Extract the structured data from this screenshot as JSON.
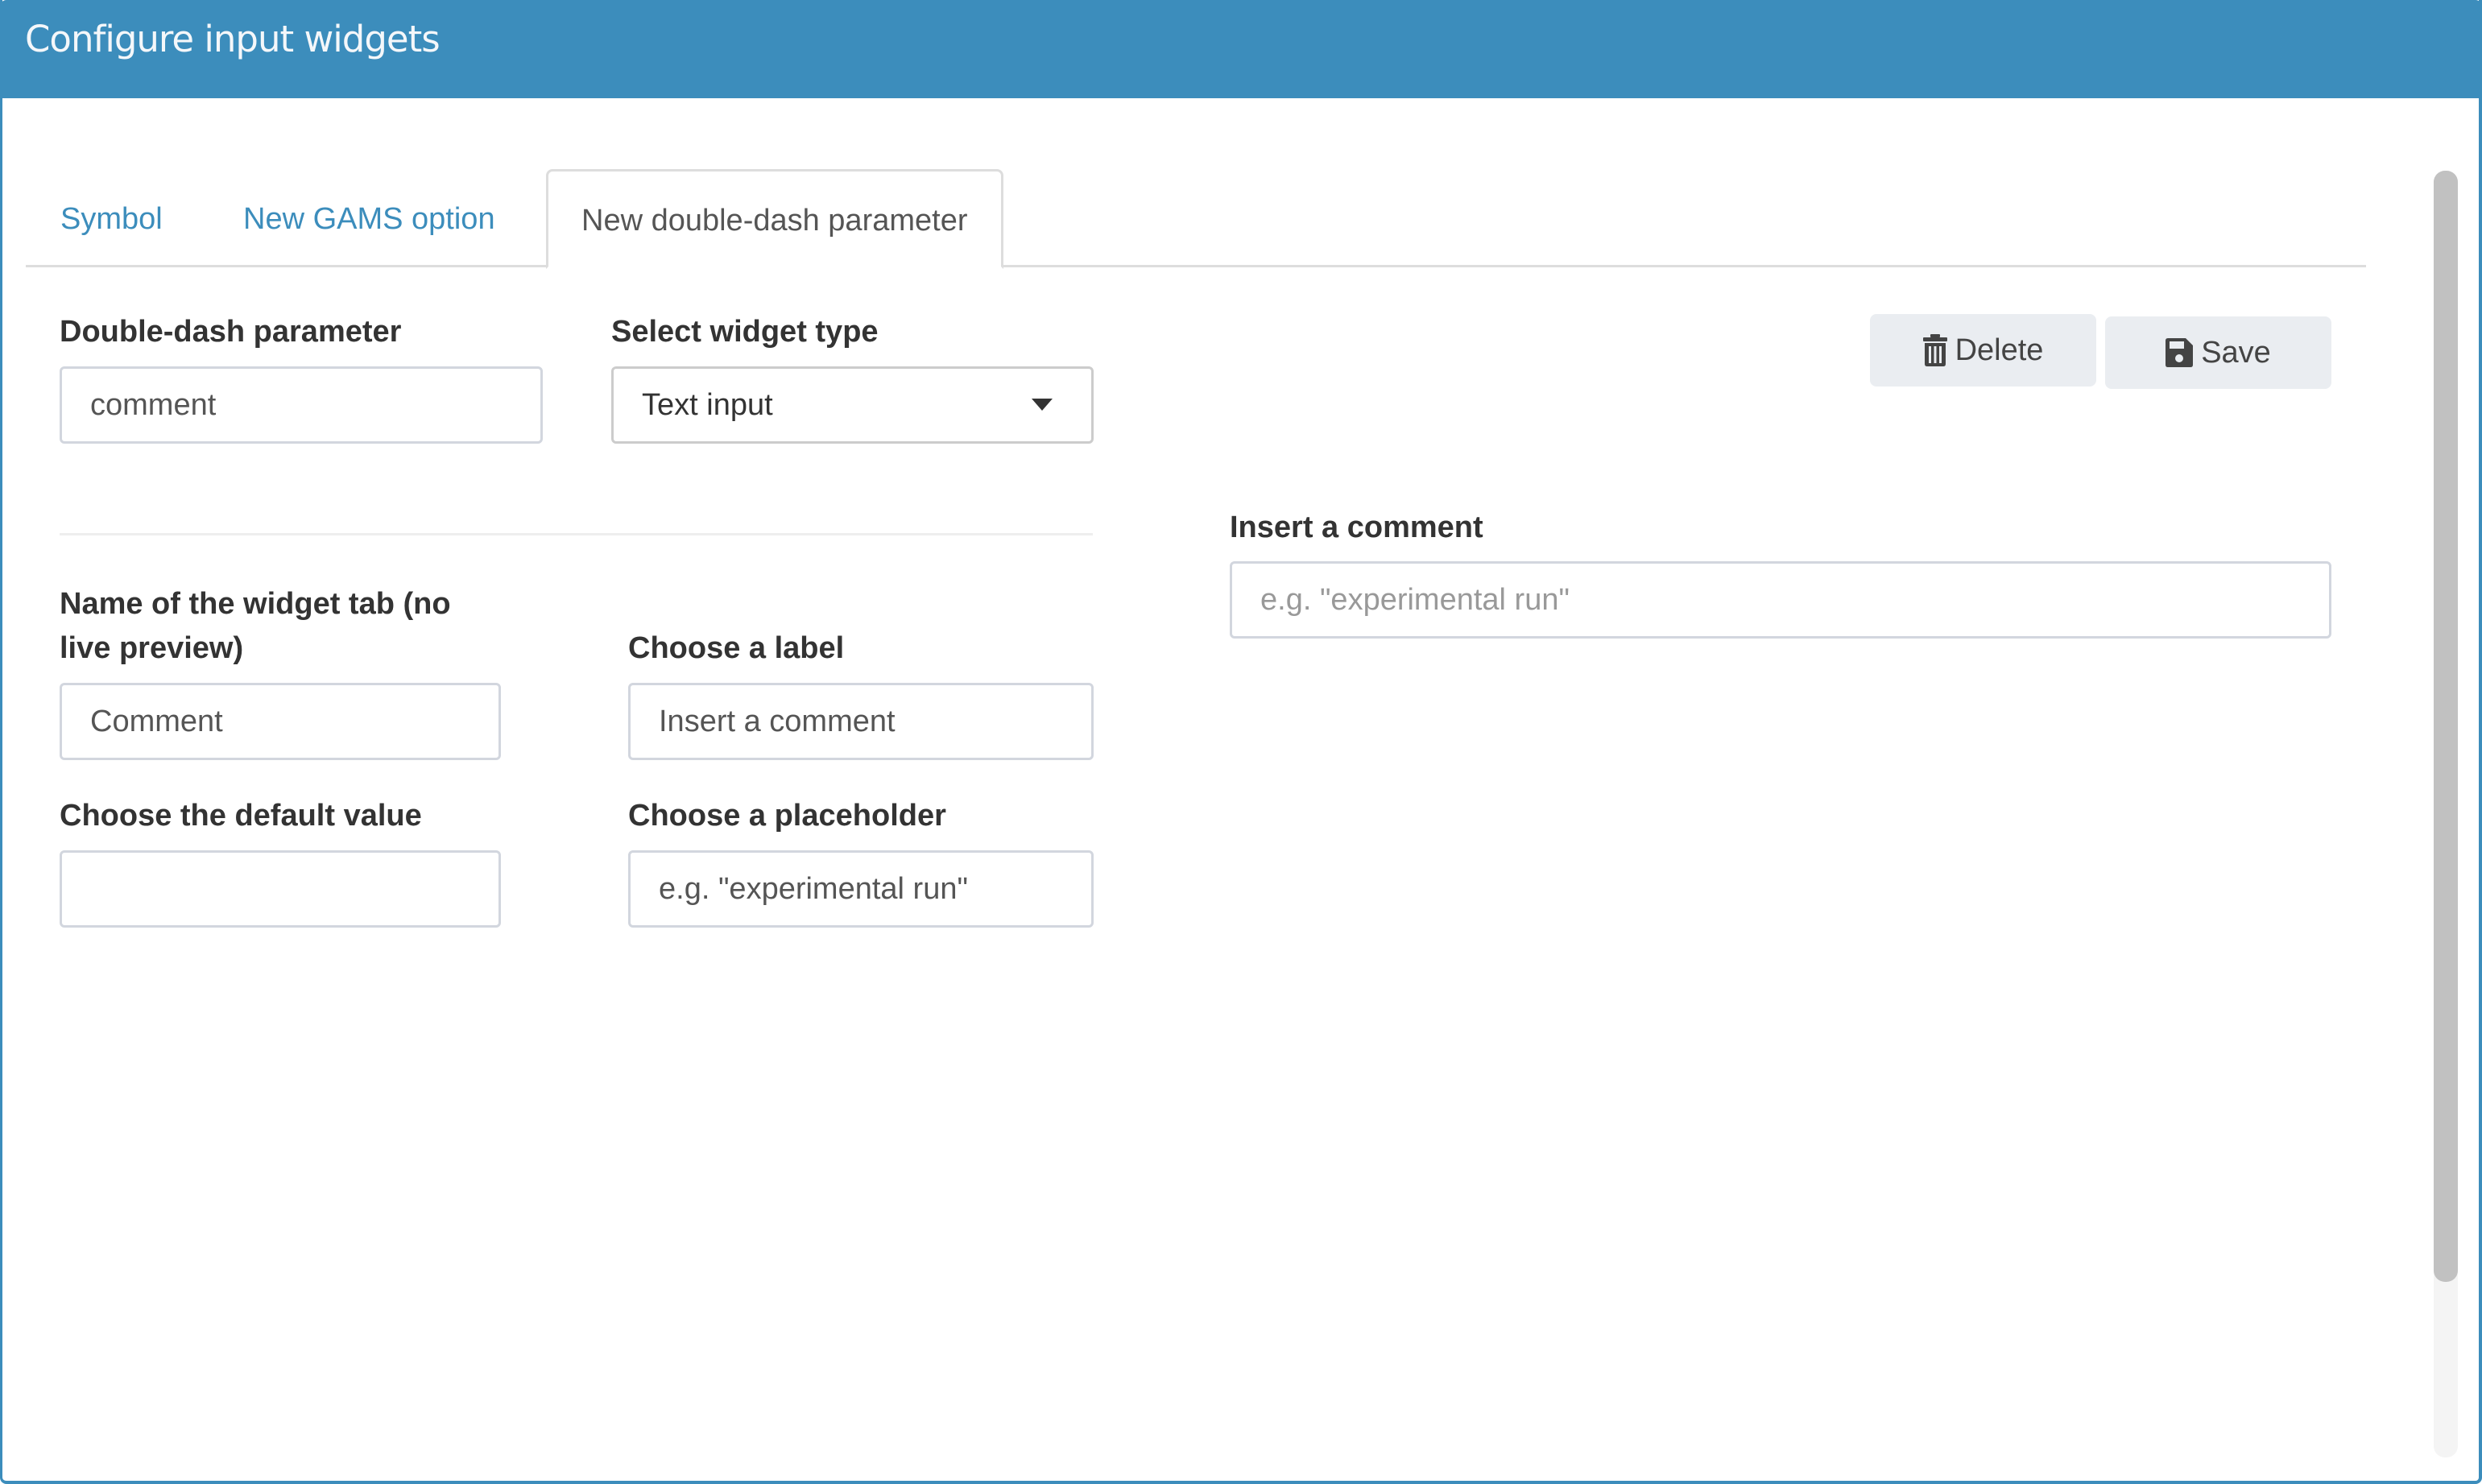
{
  "header": {
    "title": "Configure input widgets"
  },
  "tabs": [
    {
      "label": "Symbol",
      "active": false
    },
    {
      "label": "New GAMS option",
      "active": false
    },
    {
      "label": "New double-dash parameter",
      "active": true
    }
  ],
  "form": {
    "double_dash": {
      "label": "Double-dash parameter",
      "value": "comment"
    },
    "widget_type": {
      "label": "Select widget type",
      "selected": "Text input"
    },
    "tab_name": {
      "label_line1": "Name of the widget tab (no",
      "label_line2": "live preview)",
      "value": "Comment"
    },
    "choose_label": {
      "label": "Choose a label",
      "value": "Insert a comment"
    },
    "default_value": {
      "label": "Choose the default value",
      "value": ""
    },
    "placeholder": {
      "label": "Choose a placeholder",
      "value": "e.g. \"experimental run\""
    }
  },
  "actions": {
    "delete_label": "Delete",
    "delete_icon": "trash-icon",
    "save_label": "Save",
    "save_icon": "floppy-disk-icon"
  },
  "preview": {
    "label": "Insert a comment",
    "placeholder": "e.g. \"experimental run\"",
    "value": ""
  },
  "colors": {
    "header_bg": "#3c8dbc",
    "tab_link": "#3c8dbc",
    "button_bg": "#eaedf1"
  }
}
